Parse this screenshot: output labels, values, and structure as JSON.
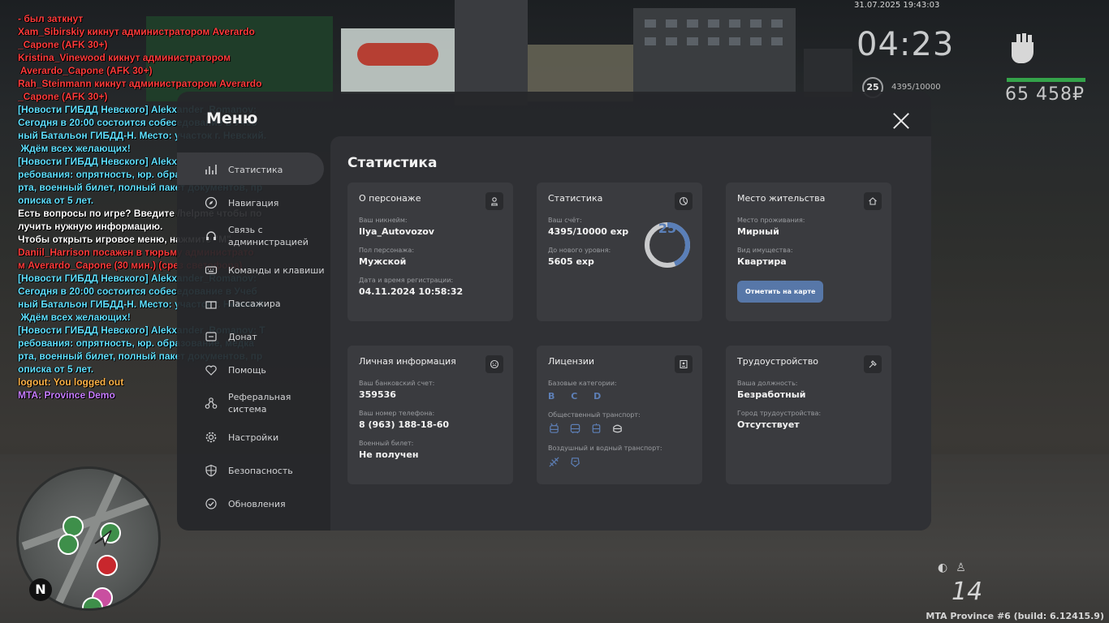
{
  "hud": {
    "datetime": "31.07.2025 19:43:03",
    "clock": "04:23",
    "level": "25",
    "exp": "4395/10000",
    "money": "65 458₽",
    "speed": "14",
    "build": "MTA Province #6 (build: 6.12415.9)"
  },
  "chat": [
    {
      "text": "- был заткнут",
      "color": "#ff3b3b"
    },
    {
      "text": "Xam_Sibirskiy кикнут администратором Averardo",
      "color": "#ff3b3b"
    },
    {
      "text": "_Capone (AFK 30+)",
      "color": "#ff3b3b"
    },
    {
      "text": "Kristina_Vinewood кикнут администратором",
      "color": "#ff3b3b"
    },
    {
      "text": " Averardo_Capone (AFK 30+)",
      "color": "#ff3b3b"
    },
    {
      "text": "Rah_Steinmann кикнут администратором Averardo",
      "color": "#ff3b3b"
    },
    {
      "text": "_Capone (AFK 30+)",
      "color": "#ff3b3b"
    },
    {
      "text": "[Новости ГИБДД Невского] Alekxander_Romanov:",
      "color": "#5fe0ff"
    },
    {
      "text": "Сегодня в 20:00 состоится собеседование в Учеб",
      "color": "#5fe0ff"
    },
    {
      "text": "ный Батальон ГИБДД-Н. Место: участок г. Невский.",
      "color": "#5fe0ff"
    },
    {
      "text": " Ждём всех желающих!",
      "color": "#5fe0ff"
    },
    {
      "text": "[Новости ГИБДД Невского] Alekxander_Romanov: Т",
      "color": "#5fe0ff"
    },
    {
      "text": "ребования: опрятность, юр. образование, медка",
      "color": "#5fe0ff"
    },
    {
      "text": "рта, военный билет, полный пакет документов, пр",
      "color": "#5fe0ff"
    },
    {
      "text": "описка от 5 лет.",
      "color": "#5fe0ff"
    },
    {
      "text": "Есть вопросы по игре? Введите /helpme чтобы по",
      "color": "#ffffff"
    },
    {
      "text": "лучить нужную информацию.",
      "color": "#ffffff"
    },
    {
      "text": "Чтобы открыть игровое меню, нажмите \"M\".",
      "color": "#ffffff"
    },
    {
      "text": "Daniil_Harrison посажен в тюрьму администрато",
      "color": "#ff3b3b"
    },
    {
      "text": "м Averardo_Capone (30 мин.) (срез светофора)",
      "color": "#ff3b3b"
    },
    {
      "text": "[Новости ГИБДД Невского] Alekxander_Romanov:",
      "color": "#5fe0ff"
    },
    {
      "text": "Сегодня в 20:00 состоится собеседование в Учеб",
      "color": "#5fe0ff"
    },
    {
      "text": "ный Батальон ГИБДД-Н. Место: участок г. Невский.",
      "color": "#5fe0ff"
    },
    {
      "text": " Ждём всех желающих!",
      "color": "#5fe0ff"
    },
    {
      "text": "[Новости ГИБДД Невского] Alekxander_Romanov: Т",
      "color": "#5fe0ff"
    },
    {
      "text": "ребования: опрятность, юр. образование, медка",
      "color": "#5fe0ff"
    },
    {
      "text": "рта, военный билет, полный пакет документов, пр",
      "color": "#5fe0ff"
    },
    {
      "text": "описка от 5 лет.",
      "color": "#5fe0ff"
    },
    {
      "text": "logout: You logged out",
      "color": "#ffb347"
    },
    {
      "text": "MTA: Province Demo",
      "color": "#c77dff"
    }
  ],
  "menu": {
    "title": "Меню",
    "sidebar": [
      {
        "label": "Статистика",
        "icon": "chart-icon"
      },
      {
        "label": "Навигация",
        "icon": "compass-icon"
      },
      {
        "label": "Связь с администрацией",
        "icon": "support-icon"
      },
      {
        "label": "Команды и клавиши",
        "icon": "keyboard-icon"
      },
      {
        "label": "Пассажира",
        "icon": "gift-icon"
      },
      {
        "label": "Донат",
        "icon": "coin-icon"
      },
      {
        "label": "Помощь",
        "icon": "heart-icon"
      },
      {
        "label": "Реферальная система",
        "icon": "referral-icon"
      },
      {
        "label": "Настройки",
        "icon": "gear-icon"
      },
      {
        "label": "Безопасность",
        "icon": "shield-icon"
      },
      {
        "label": "Обновления",
        "icon": "refresh-icon"
      }
    ],
    "content_title": "Статистика",
    "cards": {
      "character": {
        "title": "О персонаже",
        "nickname_label": "Ваш никнейм:",
        "nickname": "Ilya_Autovozov",
        "gender_label": "Пол персонажа:",
        "gender": "Мужской",
        "reg_label": "Дата и время регистрации:",
        "reg": "04.11.2024 10:58:32"
      },
      "stats": {
        "title": "Статистика",
        "exp_label": "Ваш счёт:",
        "exp": "4395/10000 exp",
        "next_label": "До нового уровня:",
        "next": "5605 exp",
        "level": "25",
        "progress": 0.4395
      },
      "residence": {
        "title": "Место жительства",
        "place_label": "Место проживания:",
        "place": "Мирный",
        "property_label": "Вид имущества:",
        "property": "Квартира",
        "button": "Отметить на карте"
      },
      "personal": {
        "title": "Личная информация",
        "bank_label": "Ваш банковский счет:",
        "bank": "359536",
        "phone_label": "Ваш номер телефона:",
        "phone": "8 (963) 188-18-60",
        "military_label": "Военный билет:",
        "military": "Не получен"
      },
      "licenses": {
        "title": "Лицензии",
        "base_label": "Базовые категории:",
        "base": "B C D",
        "public_label": "Общественный транспорт:",
        "air_label": "Воздушный и водный транспорт:"
      },
      "job": {
        "title": "Трудоустройство",
        "position_label": "Ваша должность:",
        "position": "Безработный",
        "city_label": "Город трудоустройства:",
        "city": "Отсутствует"
      }
    }
  },
  "colors": {
    "accent": "#5777a8",
    "exp_bar": "#34a34a"
  }
}
